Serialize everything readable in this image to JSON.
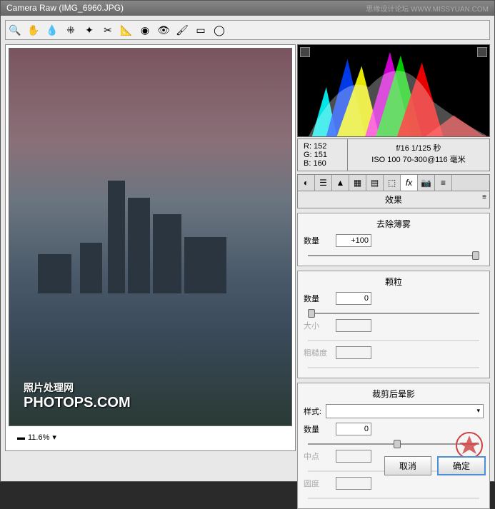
{
  "title": "Camera Raw (IMG_6960.JPG)",
  "watermark_top": "思缘设计论坛  WWW.MISSYUAN.COM",
  "zoom": {
    "level": "11.6%"
  },
  "watermark_main_cn": "照片处理网",
  "watermark_main_en": "PHOTOPS.COM",
  "metadata": {
    "r": "R:  152",
    "g": "G:  151",
    "b": "B:  160",
    "exposure": "f/16   1/125 秒",
    "iso": "ISO 100   70-300@116 毫米"
  },
  "panel_title": "效果",
  "sections": {
    "dehaze": {
      "title": "去除薄雾",
      "amount_label": "数量",
      "amount_value": "+100"
    },
    "grain": {
      "title": "颗粒",
      "amount_label": "数量",
      "amount_value": "0",
      "size_label": "大小",
      "roughness_label": "粗糙度"
    },
    "vignette": {
      "title": "裁剪后晕影",
      "style_label": "样式:",
      "amount_label": "数量",
      "amount_value": "0",
      "midpoint_label": "中点",
      "roundness_label": "圆度"
    }
  },
  "buttons": {
    "cancel": "取消",
    "ok": "确定"
  }
}
